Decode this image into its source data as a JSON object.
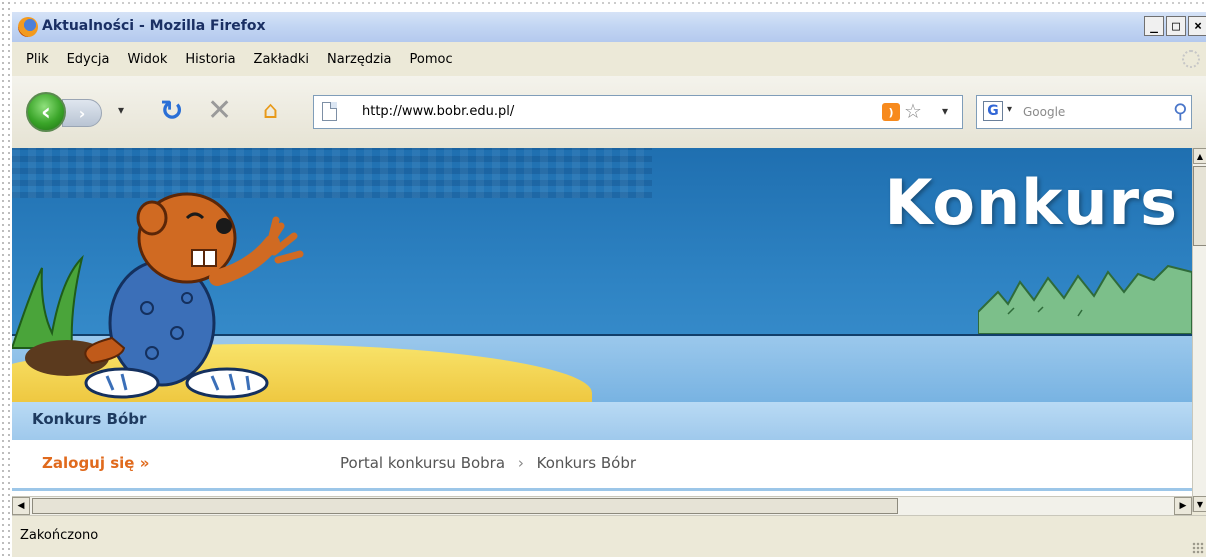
{
  "window": {
    "title": "Aktualności - Mozilla Firefox",
    "controls": [
      "_",
      "□",
      "×"
    ]
  },
  "menu": {
    "items": [
      "Plik",
      "Edycja",
      "Widok",
      "Historia",
      "Zakładki",
      "Narzędzia",
      "Pomoc"
    ]
  },
  "toolbar": {
    "url": "http://www.bobr.edu.pl/",
    "search_placeholder": "Google",
    "search_engine_icon": "G"
  },
  "page": {
    "banner_title": "Konkurs",
    "site_name": "Konkurs Bóbr",
    "login_link": "Zaloguj się »",
    "breadcrumb": [
      "Portal konkursu Bobra",
      "Konkurs Bóbr"
    ],
    "breadcrumb_separator": "›"
  },
  "statusbar": {
    "text": "Zakończono"
  },
  "colors": {
    "banner_blue": "#2f84c4",
    "login_orange": "#e06a1d",
    "nav_light_blue": "#b9daf4"
  }
}
